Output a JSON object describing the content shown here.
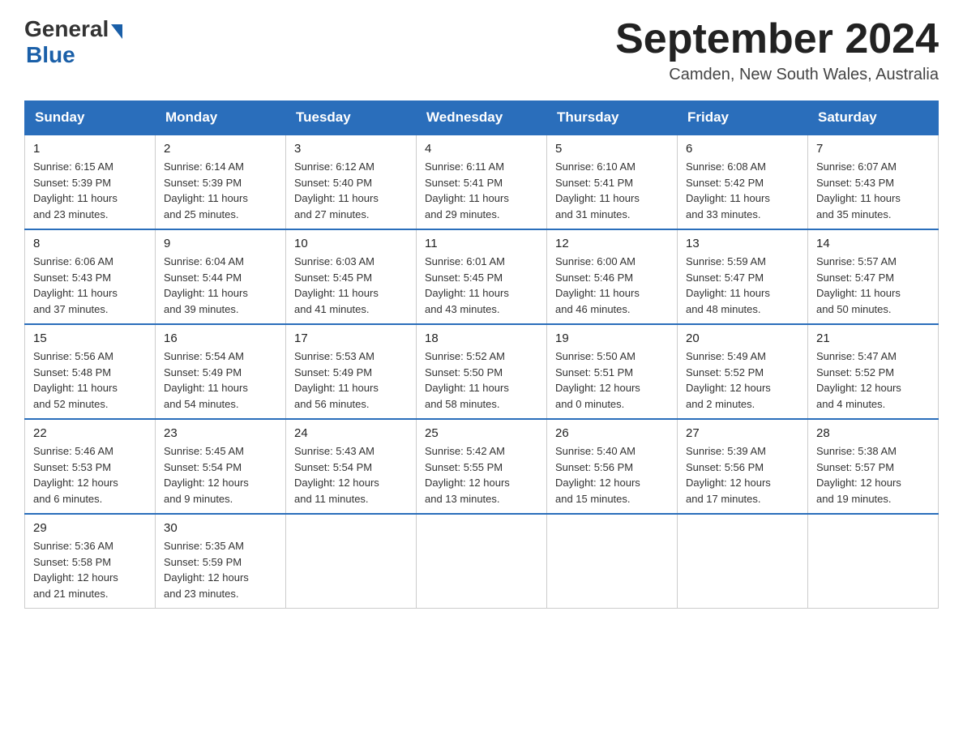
{
  "header": {
    "logo": {
      "general": "General",
      "blue": "Blue"
    },
    "title": "September 2024",
    "location": "Camden, New South Wales, Australia"
  },
  "calendar": {
    "days_of_week": [
      "Sunday",
      "Monday",
      "Tuesday",
      "Wednesday",
      "Thursday",
      "Friday",
      "Saturday"
    ],
    "weeks": [
      [
        {
          "day": "1",
          "sunrise": "6:15 AM",
          "sunset": "5:39 PM",
          "daylight": "11 hours and 23 minutes."
        },
        {
          "day": "2",
          "sunrise": "6:14 AM",
          "sunset": "5:39 PM",
          "daylight": "11 hours and 25 minutes."
        },
        {
          "day": "3",
          "sunrise": "6:12 AM",
          "sunset": "5:40 PM",
          "daylight": "11 hours and 27 minutes."
        },
        {
          "day": "4",
          "sunrise": "6:11 AM",
          "sunset": "5:41 PM",
          "daylight": "11 hours and 29 minutes."
        },
        {
          "day": "5",
          "sunrise": "6:10 AM",
          "sunset": "5:41 PM",
          "daylight": "11 hours and 31 minutes."
        },
        {
          "day": "6",
          "sunrise": "6:08 AM",
          "sunset": "5:42 PM",
          "daylight": "11 hours and 33 minutes."
        },
        {
          "day": "7",
          "sunrise": "6:07 AM",
          "sunset": "5:43 PM",
          "daylight": "11 hours and 35 minutes."
        }
      ],
      [
        {
          "day": "8",
          "sunrise": "6:06 AM",
          "sunset": "5:43 PM",
          "daylight": "11 hours and 37 minutes."
        },
        {
          "day": "9",
          "sunrise": "6:04 AM",
          "sunset": "5:44 PM",
          "daylight": "11 hours and 39 minutes."
        },
        {
          "day": "10",
          "sunrise": "6:03 AM",
          "sunset": "5:45 PM",
          "daylight": "11 hours and 41 minutes."
        },
        {
          "day": "11",
          "sunrise": "6:01 AM",
          "sunset": "5:45 PM",
          "daylight": "11 hours and 43 minutes."
        },
        {
          "day": "12",
          "sunrise": "6:00 AM",
          "sunset": "5:46 PM",
          "daylight": "11 hours and 46 minutes."
        },
        {
          "day": "13",
          "sunrise": "5:59 AM",
          "sunset": "5:47 PM",
          "daylight": "11 hours and 48 minutes."
        },
        {
          "day": "14",
          "sunrise": "5:57 AM",
          "sunset": "5:47 PM",
          "daylight": "11 hours and 50 minutes."
        }
      ],
      [
        {
          "day": "15",
          "sunrise": "5:56 AM",
          "sunset": "5:48 PM",
          "daylight": "11 hours and 52 minutes."
        },
        {
          "day": "16",
          "sunrise": "5:54 AM",
          "sunset": "5:49 PM",
          "daylight": "11 hours and 54 minutes."
        },
        {
          "day": "17",
          "sunrise": "5:53 AM",
          "sunset": "5:49 PM",
          "daylight": "11 hours and 56 minutes."
        },
        {
          "day": "18",
          "sunrise": "5:52 AM",
          "sunset": "5:50 PM",
          "daylight": "11 hours and 58 minutes."
        },
        {
          "day": "19",
          "sunrise": "5:50 AM",
          "sunset": "5:51 PM",
          "daylight": "12 hours and 0 minutes."
        },
        {
          "day": "20",
          "sunrise": "5:49 AM",
          "sunset": "5:52 PM",
          "daylight": "12 hours and 2 minutes."
        },
        {
          "day": "21",
          "sunrise": "5:47 AM",
          "sunset": "5:52 PM",
          "daylight": "12 hours and 4 minutes."
        }
      ],
      [
        {
          "day": "22",
          "sunrise": "5:46 AM",
          "sunset": "5:53 PM",
          "daylight": "12 hours and 6 minutes."
        },
        {
          "day": "23",
          "sunrise": "5:45 AM",
          "sunset": "5:54 PM",
          "daylight": "12 hours and 9 minutes."
        },
        {
          "day": "24",
          "sunrise": "5:43 AM",
          "sunset": "5:54 PM",
          "daylight": "12 hours and 11 minutes."
        },
        {
          "day": "25",
          "sunrise": "5:42 AM",
          "sunset": "5:55 PM",
          "daylight": "12 hours and 13 minutes."
        },
        {
          "day": "26",
          "sunrise": "5:40 AM",
          "sunset": "5:56 PM",
          "daylight": "12 hours and 15 minutes."
        },
        {
          "day": "27",
          "sunrise": "5:39 AM",
          "sunset": "5:56 PM",
          "daylight": "12 hours and 17 minutes."
        },
        {
          "day": "28",
          "sunrise": "5:38 AM",
          "sunset": "5:57 PM",
          "daylight": "12 hours and 19 minutes."
        }
      ],
      [
        {
          "day": "29",
          "sunrise": "5:36 AM",
          "sunset": "5:58 PM",
          "daylight": "12 hours and 21 minutes."
        },
        {
          "day": "30",
          "sunrise": "5:35 AM",
          "sunset": "5:59 PM",
          "daylight": "12 hours and 23 minutes."
        },
        null,
        null,
        null,
        null,
        null
      ]
    ]
  }
}
